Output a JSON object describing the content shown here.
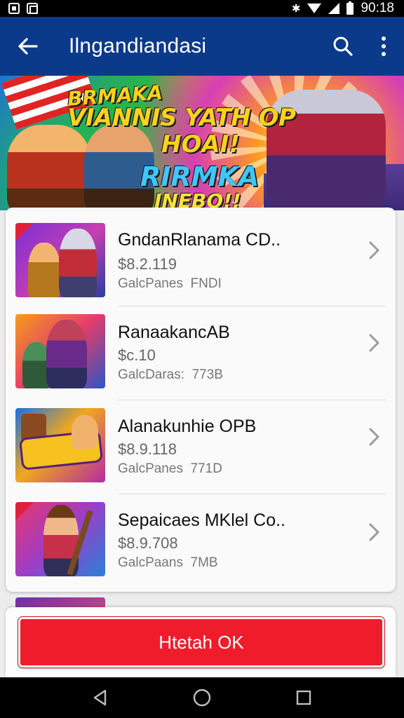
{
  "status_bar": {
    "time": "90:18"
  },
  "app_bar": {
    "title": "Ilngandiandasi",
    "back_icon": "arrow-left-icon",
    "search_icon": "search-icon",
    "menu_icon": "more-vertical-icon"
  },
  "banner": {
    "line1": "BRMAKA",
    "line2": "VIANNIS YATH OP",
    "line3": "HOAI!",
    "line4": "RIRMKA",
    "line5": "INEBO!!"
  },
  "list": {
    "items": [
      {
        "title": "GndanRlanama CD..",
        "price": "$8.2.119",
        "meta_label": "GalcPanes",
        "meta_value": "FNDI"
      },
      {
        "title": "RanaakancAB",
        "price": "$c.10",
        "meta_label": "GalcDaras:",
        "meta_value": "773B"
      },
      {
        "title": "Alanakunhie OPB",
        "price": "$8.9.118",
        "meta_label": "GalcPanes",
        "meta_value": "771D"
      },
      {
        "title": "Sepaicaes MKlel Co..",
        "price": "$8.9.708",
        "meta_label": "GalcPaans",
        "meta_value": "7MB"
      }
    ]
  },
  "cta": {
    "label": "Htetah OK"
  },
  "colors": {
    "app_bar": "#0c3a8a",
    "cta": "#f01c2c"
  }
}
